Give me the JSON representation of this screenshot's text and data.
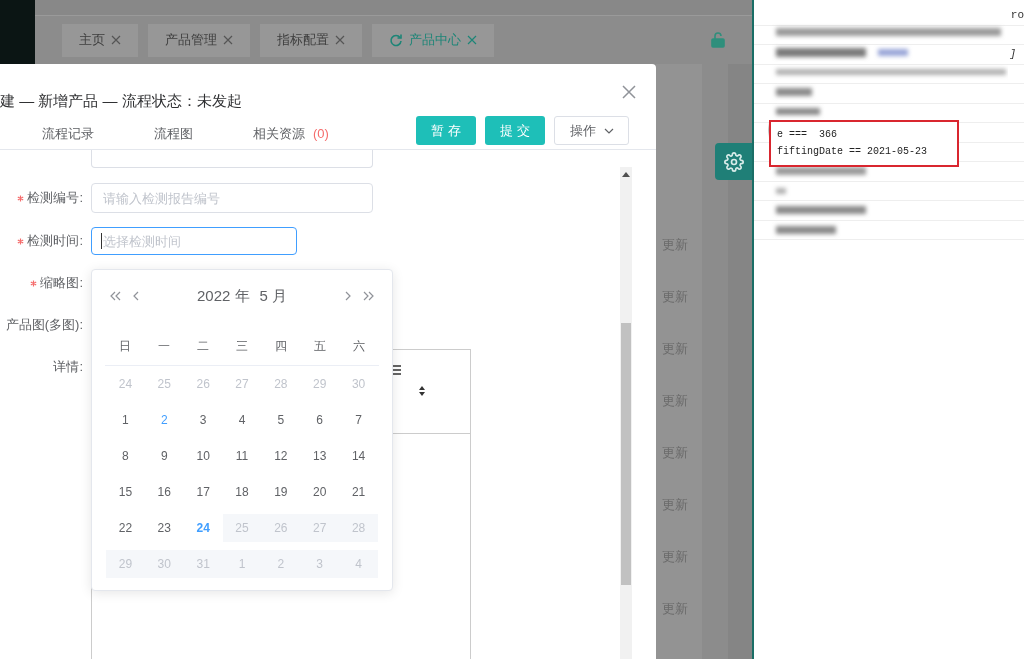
{
  "tabs": [
    {
      "label": "主页",
      "selected": false
    },
    {
      "label": "产品管理",
      "selected": false
    },
    {
      "label": "指标配置",
      "selected": false
    },
    {
      "label": "产品中心",
      "selected": true
    }
  ],
  "background_links": [
    "更新",
    "更新",
    "更新",
    "更新",
    "更新",
    "更新",
    "更新",
    "更新"
  ],
  "dialog": {
    "title": "建 — 新增产品 — 流程状态：未发起",
    "tabs": [
      {
        "label": "流程记录"
      },
      {
        "label": "流程图"
      },
      {
        "label": "相关资源",
        "count": "(0)"
      }
    ],
    "buttons": [
      {
        "label": "暂 存",
        "kind": "primary"
      },
      {
        "label": "提 交",
        "kind": "primary"
      },
      {
        "label": "操作",
        "kind": "dropdown"
      }
    ],
    "form": [
      {
        "label": "检测编号:",
        "required": true,
        "kind": "input",
        "placeholder": "请输入检测报告编号",
        "focused": false
      },
      {
        "label": "检测时间:",
        "required": true,
        "kind": "date",
        "placeholder": "选择检测时间",
        "focused": true
      },
      {
        "label": "缩略图:",
        "required": true,
        "kind": "upload"
      },
      {
        "label": "产品图(多图):",
        "required": false,
        "kind": "upload"
      },
      {
        "label": "详情:",
        "required": false,
        "kind": "editor"
      }
    ]
  },
  "date_picker": {
    "year": "2022 年",
    "month": "5 月",
    "weekdays": [
      "日",
      "一",
      "二",
      "三",
      "四",
      "五",
      "六"
    ],
    "weeks": [
      [
        {
          "day": "24",
          "kind": "other"
        },
        {
          "day": "25",
          "kind": "other"
        },
        {
          "day": "26",
          "kind": "other"
        },
        {
          "day": "27",
          "kind": "other"
        },
        {
          "day": "28",
          "kind": "other"
        },
        {
          "day": "29",
          "kind": "other"
        },
        {
          "day": "30",
          "kind": "other"
        }
      ],
      [
        {
          "day": "1",
          "kind": "normal"
        },
        {
          "day": "2",
          "kind": "marked"
        },
        {
          "day": "3",
          "kind": "normal"
        },
        {
          "day": "4",
          "kind": "normal"
        },
        {
          "day": "5",
          "kind": "normal"
        },
        {
          "day": "6",
          "kind": "normal"
        },
        {
          "day": "7",
          "kind": "normal"
        }
      ],
      [
        {
          "day": "8",
          "kind": "normal"
        },
        {
          "day": "9",
          "kind": "normal"
        },
        {
          "day": "10",
          "kind": "normal"
        },
        {
          "day": "11",
          "kind": "normal"
        },
        {
          "day": "12",
          "kind": "normal"
        },
        {
          "day": "13",
          "kind": "normal"
        },
        {
          "day": "14",
          "kind": "normal"
        }
      ],
      [
        {
          "day": "15",
          "kind": "normal"
        },
        {
          "day": "16",
          "kind": "normal"
        },
        {
          "day": "17",
          "kind": "normal"
        },
        {
          "day": "18",
          "kind": "normal"
        },
        {
          "day": "19",
          "kind": "normal"
        },
        {
          "day": "20",
          "kind": "normal"
        },
        {
          "day": "21",
          "kind": "normal"
        }
      ],
      [
        {
          "day": "22",
          "kind": "normal"
        },
        {
          "day": "23",
          "kind": "normal"
        },
        {
          "day": "24",
          "kind": "today"
        },
        {
          "day": "25",
          "kind": "disabled"
        },
        {
          "day": "26",
          "kind": "disabled"
        },
        {
          "day": "27",
          "kind": "disabled"
        },
        {
          "day": "28",
          "kind": "disabled"
        }
      ],
      [
        {
          "day": "29",
          "kind": "disabled"
        },
        {
          "day": "30",
          "kind": "disabled"
        },
        {
          "day": "31",
          "kind": "disabled"
        },
        {
          "day": "1",
          "kind": "disabled"
        },
        {
          "day": "2",
          "kind": "disabled"
        },
        {
          "day": "3",
          "kind": "disabled"
        },
        {
          "day": "4",
          "kind": "disabled"
        }
      ]
    ]
  },
  "console": {
    "fragments": [
      "ro",
      "]"
    ],
    "highlighted_lines": [
      "e ===  366",
      "fiftingDate == 2021-05-23"
    ]
  }
}
